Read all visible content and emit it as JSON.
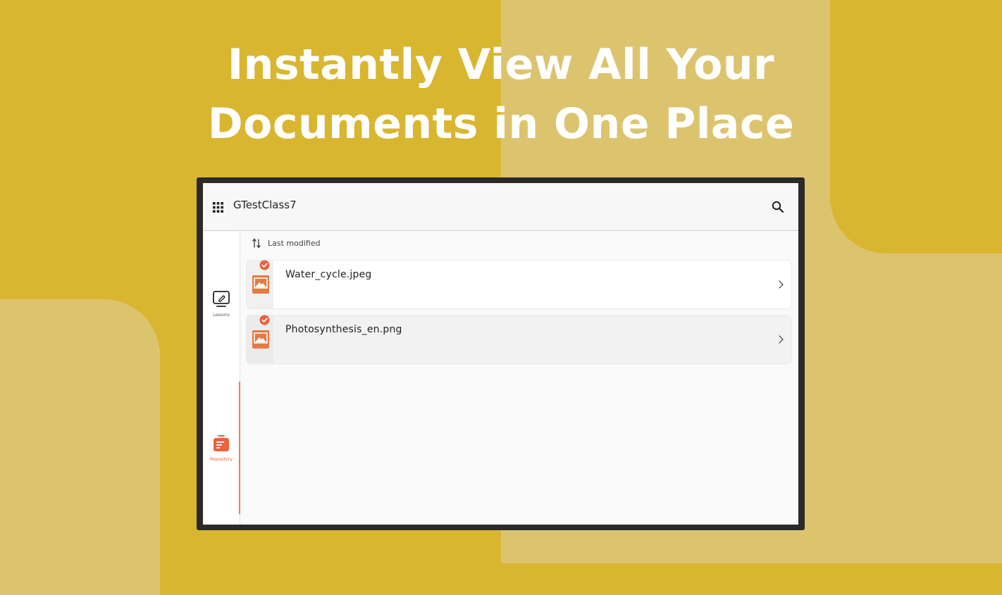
{
  "headline": {
    "line1": "Instantly View All Your",
    "line2": "Documents in One Place"
  },
  "app": {
    "title": "GTestClass7",
    "menu_icon": "apps-grid-icon",
    "search_icon": "search-icon"
  },
  "sidebar": {
    "items": [
      {
        "label": "Lessons",
        "icon": "lesson-edit-icon",
        "active": false
      },
      {
        "label": "Repository",
        "icon": "repository-icon",
        "active": true
      }
    ]
  },
  "sort": {
    "label": "Last modified",
    "icon": "sort-icon"
  },
  "files": [
    {
      "name": "Water_cycle.jpeg",
      "icon": "image-file-icon",
      "status": "check-icon"
    },
    {
      "name": "Photosynthesis_en.png",
      "icon": "image-file-icon",
      "status": "check-icon"
    }
  ],
  "colors": {
    "accent": "#e8643c",
    "background": "#d9b630",
    "background_light": "#dcc46f"
  }
}
